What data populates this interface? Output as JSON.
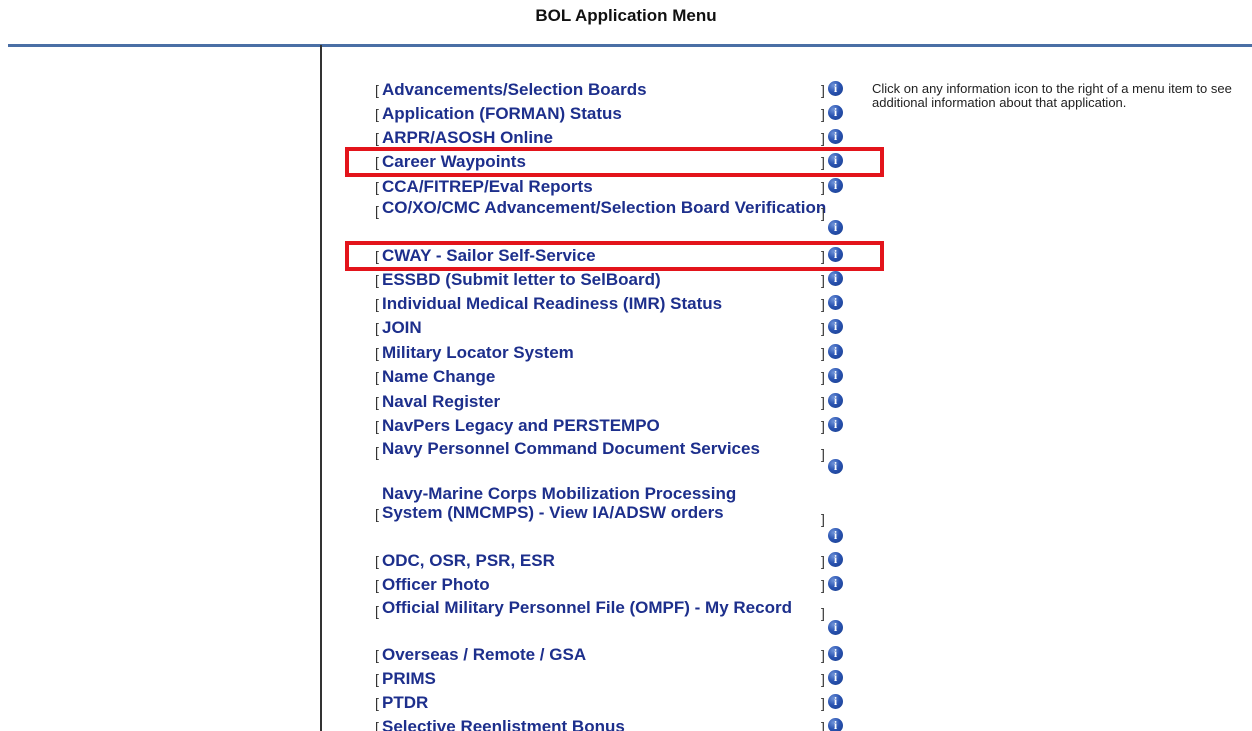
{
  "page": {
    "title": "BOL Application Menu"
  },
  "help": {
    "text": "Click on any information icon to the right of a menu item to see additional information about that application."
  },
  "menu": {
    "bracket_open": "[",
    "bracket_close": "]",
    "info_icon_glyph": "i",
    "items": [
      {
        "label": "Advancements/Selection Boards",
        "icon": "info-icon"
      },
      {
        "label": "Application (FORMAN) Status",
        "icon": "info-icon"
      },
      {
        "label": "ARPR/ASOSH Online",
        "icon": "info-icon"
      },
      {
        "label": "Career Waypoints",
        "icon": "info-icon",
        "highlighted": true
      },
      {
        "label": "CCA/FITREP/Eval Reports",
        "icon": "info-icon"
      },
      {
        "label": "CO/XO/CMC Advancement/Selection Board Verification",
        "icon": "info-icon"
      },
      {
        "label": "CWAY - Sailor Self-Service",
        "icon": "info-icon",
        "highlighted": true
      },
      {
        "label": "ESSBD (Submit letter to SelBoard)",
        "icon": "info-icon"
      },
      {
        "label": "Individual Medical Readiness (IMR) Status",
        "icon": "info-icon"
      },
      {
        "label": "JOIN",
        "icon": "info-icon"
      },
      {
        "label": "Military Locator System",
        "icon": "info-icon"
      },
      {
        "label": "Name Change",
        "icon": "info-icon"
      },
      {
        "label": "Naval Register",
        "icon": "info-icon"
      },
      {
        "label": "NavPers Legacy and PERSTEMPO",
        "icon": "info-icon"
      },
      {
        "label": "Navy Personnel Command Document Services",
        "icon": "info-icon"
      },
      {
        "label": "Navy-Marine Corps Mobilization Processing System (NMCMPS) - View IA/ADSW orders",
        "icon": "info-icon"
      },
      {
        "label": "ODC, OSR, PSR, ESR",
        "icon": "info-icon"
      },
      {
        "label": "Officer Photo",
        "icon": "info-icon"
      },
      {
        "label": "Official Military Personnel File (OMPF) - My Record",
        "icon": "info-icon"
      },
      {
        "label": "Overseas / Remote / GSA",
        "icon": "info-icon"
      },
      {
        "label": "PRIMS",
        "icon": "info-icon"
      },
      {
        "label": "PTDR",
        "icon": "info-icon"
      },
      {
        "label": "Selective Reenlistment Bonus",
        "icon": "info-icon"
      }
    ]
  },
  "colors": {
    "link": "#1d2f8c",
    "highlight_border": "#e3141b",
    "header_rule": "#4a6fa5",
    "info_icon": "#2a54b2"
  }
}
